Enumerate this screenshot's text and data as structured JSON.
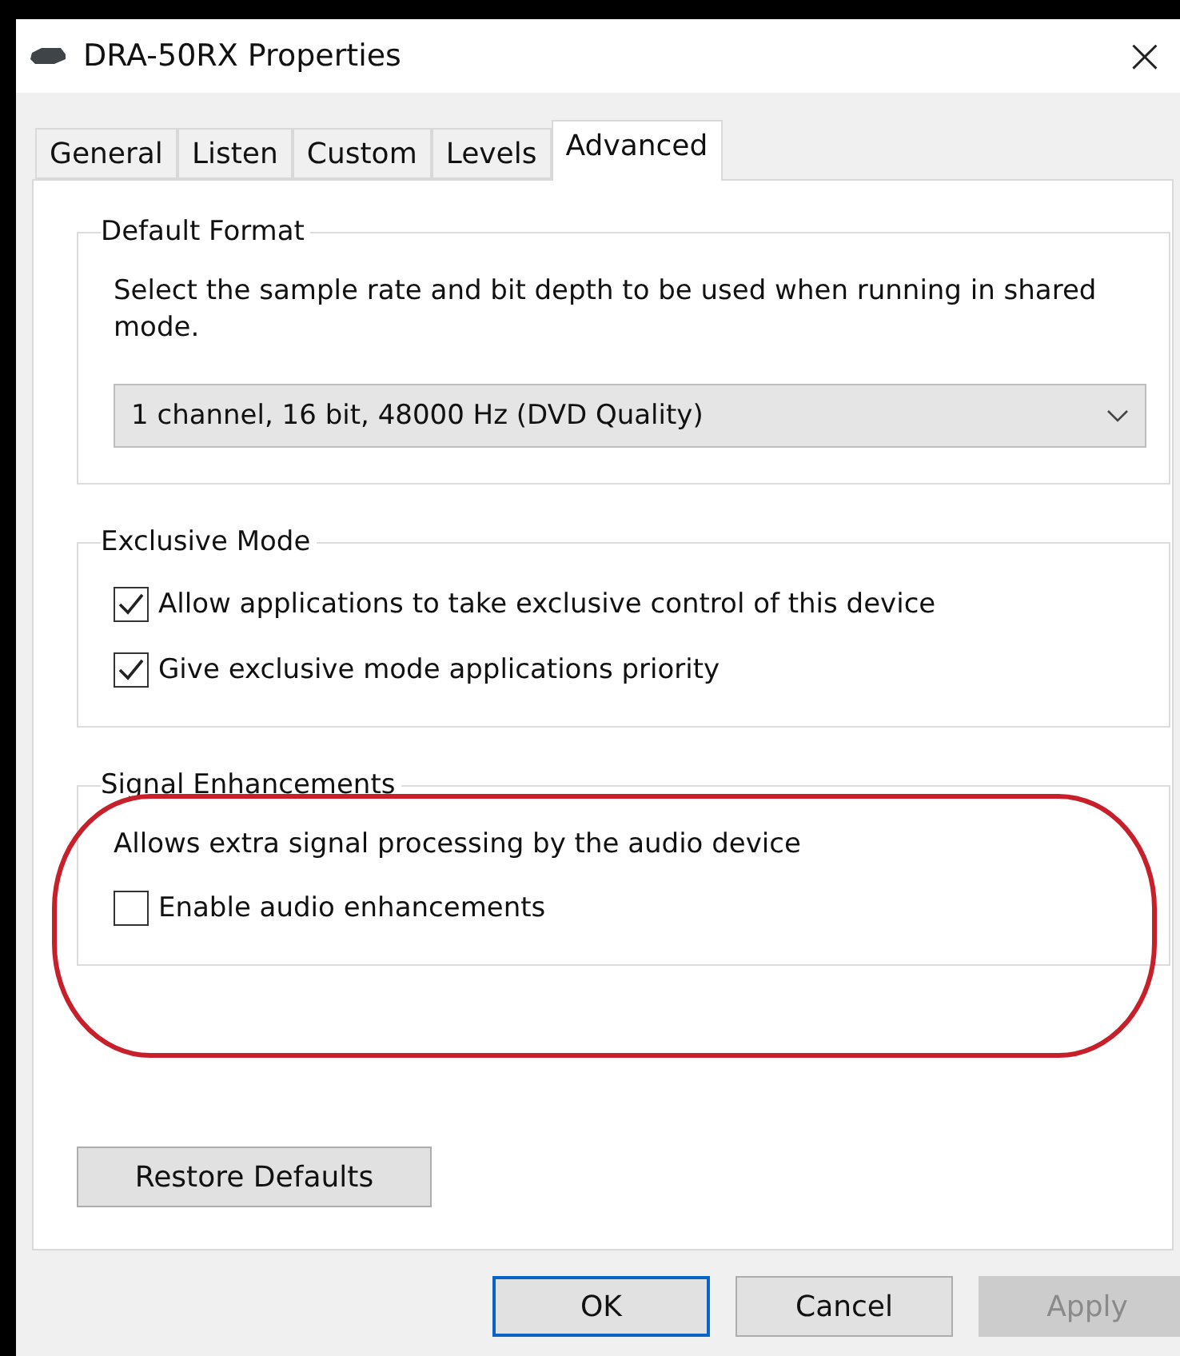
{
  "window": {
    "title": "DRA-50RX Properties",
    "close": "×"
  },
  "tabs": [
    {
      "label": "General",
      "selected": false
    },
    {
      "label": "Listen",
      "selected": false
    },
    {
      "label": "Custom",
      "selected": false
    },
    {
      "label": "Levels",
      "selected": false
    },
    {
      "label": "Advanced",
      "selected": true
    }
  ],
  "groups": [
    {
      "title": "Default Format",
      "items": [
        {
          "kind": "text",
          "text": "Select the sample rate and bit depth to be used when running in shared mode."
        },
        {
          "kind": "dropdown",
          "value": "1 channel, 16 bit, 48000 Hz (DVD Quality)"
        }
      ]
    },
    {
      "title": "Exclusive Mode",
      "items": [
        {
          "kind": "checkbox",
          "label": "Allow applications to take exclusive control of this device",
          "checked": true
        },
        {
          "kind": "checkbox",
          "label": "Give exclusive mode applications priority",
          "checked": true
        }
      ]
    },
    {
      "title": "Signal Enhancements",
      "items": [
        {
          "kind": "text",
          "text": "Allows extra signal processing by the audio device"
        },
        {
          "kind": "checkbox",
          "label": "Enable audio enhancements",
          "checked": false
        }
      ]
    }
  ],
  "restore_button": "Restore Defaults",
  "buttons": [
    {
      "label": "OK",
      "default": true,
      "disabled": false
    },
    {
      "label": "Cancel",
      "default": false,
      "disabled": false
    },
    {
      "label": "Apply",
      "default": false,
      "disabled": true
    }
  ]
}
